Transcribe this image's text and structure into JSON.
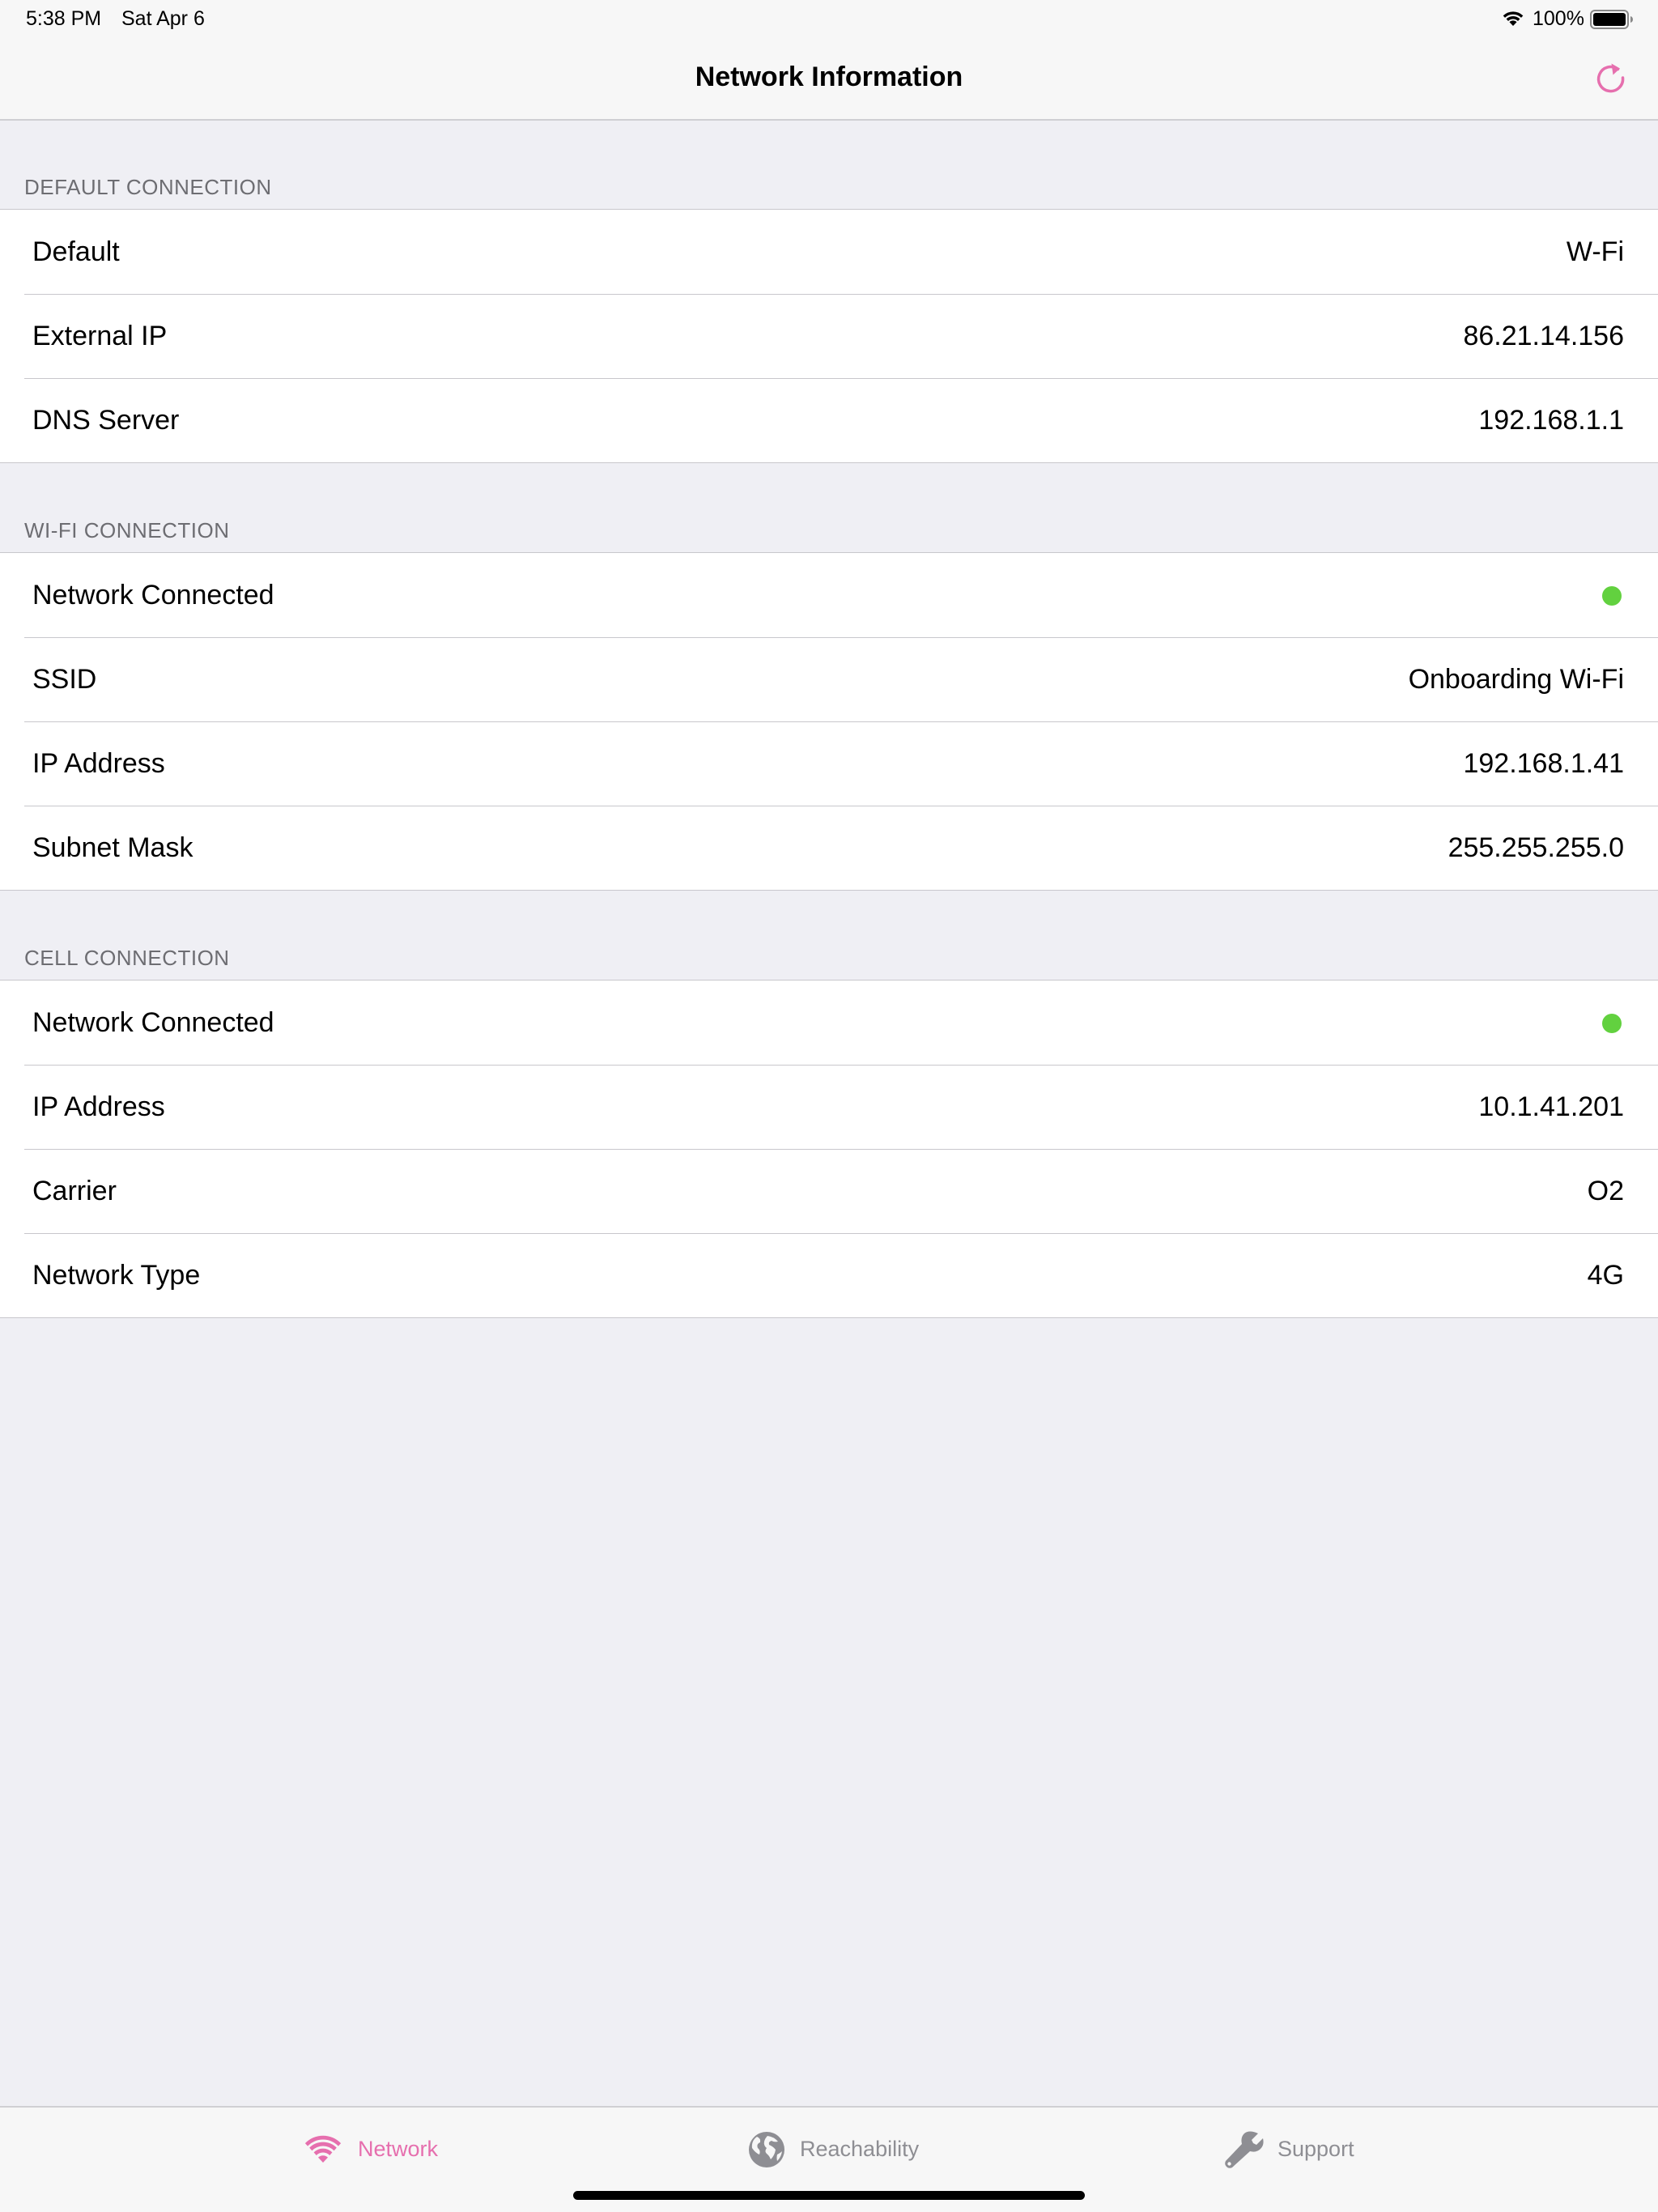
{
  "status_bar": {
    "time": "5:38 PM",
    "date": "Sat Apr 6",
    "battery_percent": "100%",
    "battery_level": 1.0,
    "icons": [
      "wifi-icon",
      "battery-icon"
    ]
  },
  "nav": {
    "title": "Network Information",
    "refresh_icon": "refresh-icon"
  },
  "colors": {
    "accent": "#e66fae",
    "status_green": "#62d13f",
    "tab_inactive": "#8e8e93",
    "background": "#efeff4"
  },
  "sections": [
    {
      "header": "DEFAULT CONNECTION",
      "rows": [
        {
          "label": "Default",
          "value": "W-Fi"
        },
        {
          "label": "External IP",
          "value": "86.21.14.156"
        },
        {
          "label": "DNS Server",
          "value": "192.168.1.1"
        }
      ]
    },
    {
      "header": "WI-FI CONNECTION",
      "rows": [
        {
          "label": "Network Connected",
          "status": "connected"
        },
        {
          "label": "SSID",
          "value": "Onboarding Wi-Fi"
        },
        {
          "label": "IP Address",
          "value": "192.168.1.41"
        },
        {
          "label": "Subnet Mask",
          "value": "255.255.255.0"
        }
      ]
    },
    {
      "header": "CELL CONNECTION",
      "rows": [
        {
          "label": "Network Connected",
          "status": "connected"
        },
        {
          "label": "IP Address",
          "value": "10.1.41.201"
        },
        {
          "label": "Carrier",
          "value": "O2"
        },
        {
          "label": "Network Type",
          "value": "4G"
        }
      ]
    }
  ],
  "tabs": [
    {
      "label": "Network",
      "icon": "wifi-icon",
      "selected": true
    },
    {
      "label": "Reachability",
      "icon": "globe-icon",
      "selected": false
    },
    {
      "label": "Support",
      "icon": "wrench-icon",
      "selected": false
    }
  ]
}
